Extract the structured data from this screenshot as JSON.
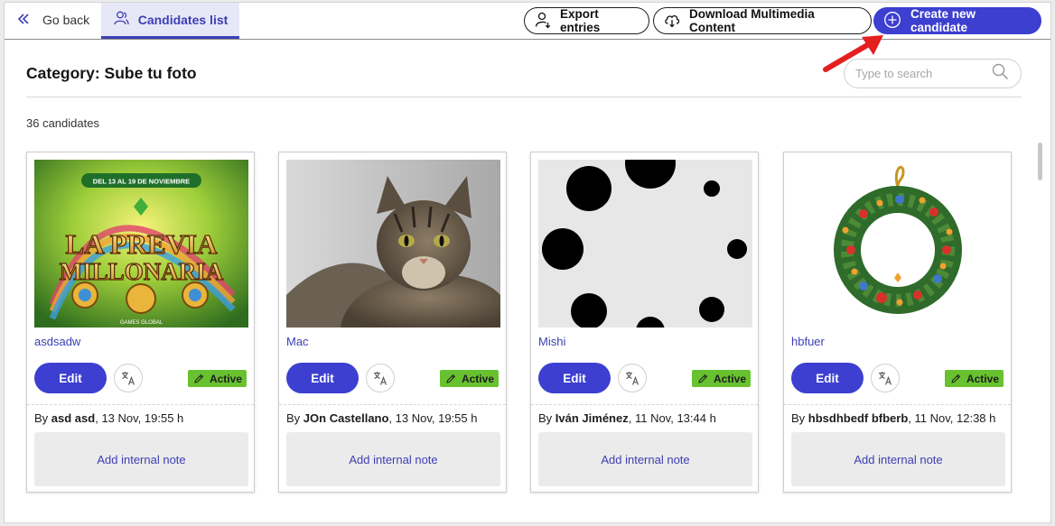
{
  "topbar": {
    "go_back_label": "Go back",
    "active_tab_label": "Candidates list",
    "export_label": "Export entries",
    "download_label": "Download Multimedia Content",
    "create_label": "Create new candidate"
  },
  "page": {
    "title": "Category: Sube tu foto",
    "count": "36 candidates"
  },
  "search": {
    "placeholder": "Type to search",
    "value": ""
  },
  "colors": {
    "primary": "#3c3fd0",
    "active_badge": "#68c22f",
    "annotation_arrow": "#e32020"
  },
  "candidates": [
    {
      "name": "asdsadw",
      "edit_label": "Edit",
      "status": "Active",
      "by_prefix": "By",
      "author": "asd asd",
      "date": ", 13 Nov, 19:55 h",
      "note_label": "Add internal note",
      "image": "promo-banner"
    },
    {
      "name": "Mac",
      "edit_label": "Edit",
      "status": "Active",
      "by_prefix": "By",
      "author": "JOn Castellano",
      "date": ", 13 Nov, 19:55 h",
      "note_label": "Add internal note",
      "image": "tabby-cat-photo"
    },
    {
      "name": "Mishi",
      "edit_label": "Edit",
      "status": "Active",
      "by_prefix": "By",
      "author": "Iván Jiménez",
      "date": ", 11 Nov, 13:44 h",
      "note_label": "Add internal note",
      "image": "black-dots-pattern"
    },
    {
      "name": "hbfuer",
      "edit_label": "Edit",
      "status": "Active",
      "by_prefix": "By",
      "author": "hbsdhbedf bfberb",
      "date": ", 11 Nov, 12:38 h",
      "note_label": "Add internal note",
      "image": "christmas-wreath"
    }
  ],
  "promo_banner": {
    "dates": "DEL 13 AL 19 DE NOVIEMBRE",
    "line1": "LA PREVIA",
    "line2": "MILLONARIA",
    "brand": "GAMES GLOBAL"
  }
}
